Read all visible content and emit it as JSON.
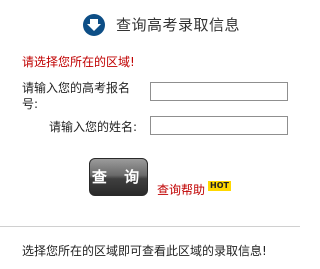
{
  "header": {
    "title": "查询高考录取信息",
    "icon": "download-arrow-icon",
    "icon_color": "#0d4e86"
  },
  "form": {
    "region_hint": "请选择您所在的区域!",
    "exam_number_label": "请输入您的高考报名号:",
    "exam_number_value": "",
    "name_label": "请输入您的姓名:",
    "name_value": "",
    "query_button_label": "查 询",
    "help_link_label": "查询帮助",
    "hot_badge": "HOT"
  },
  "footer": {
    "note": "选择您所在的区域即可查看此区域的录取信息!"
  },
  "colors": {
    "hint_red": "#c00000",
    "button_dark": "#2a2a2a",
    "hot_yellow": "#ffd800"
  }
}
